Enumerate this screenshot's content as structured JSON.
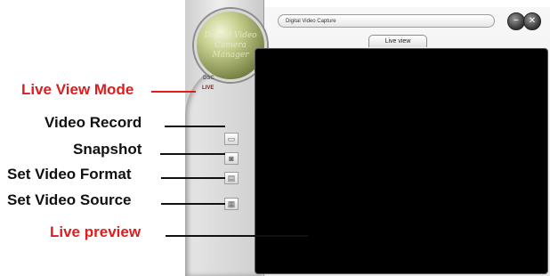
{
  "app": {
    "title_field": "Digital Video Capture",
    "active_tab": "Live view",
    "mode_options": [
      "DSC",
      "LIVE"
    ],
    "logo_text": "Digital Video Camera Manager"
  },
  "icons": {
    "video_record": "video-camera-icon",
    "snapshot": "camera-icon",
    "set_video_format": "clapperboard-icon",
    "set_video_source": "film-icon",
    "window_minimize": "minimize-icon",
    "window_close": "close-icon"
  },
  "callouts": {
    "live_view_mode": "Live View Mode",
    "video_record": "Video Record",
    "snapshot": "Snapshot",
    "set_video_format": "Set Video Format",
    "set_video_source": "Set Video Source",
    "live_preview": "Live preview"
  },
  "colors": {
    "callout_highlight": "#e01c1c",
    "callout_default": "#111111",
    "preview_background": "#000000"
  }
}
